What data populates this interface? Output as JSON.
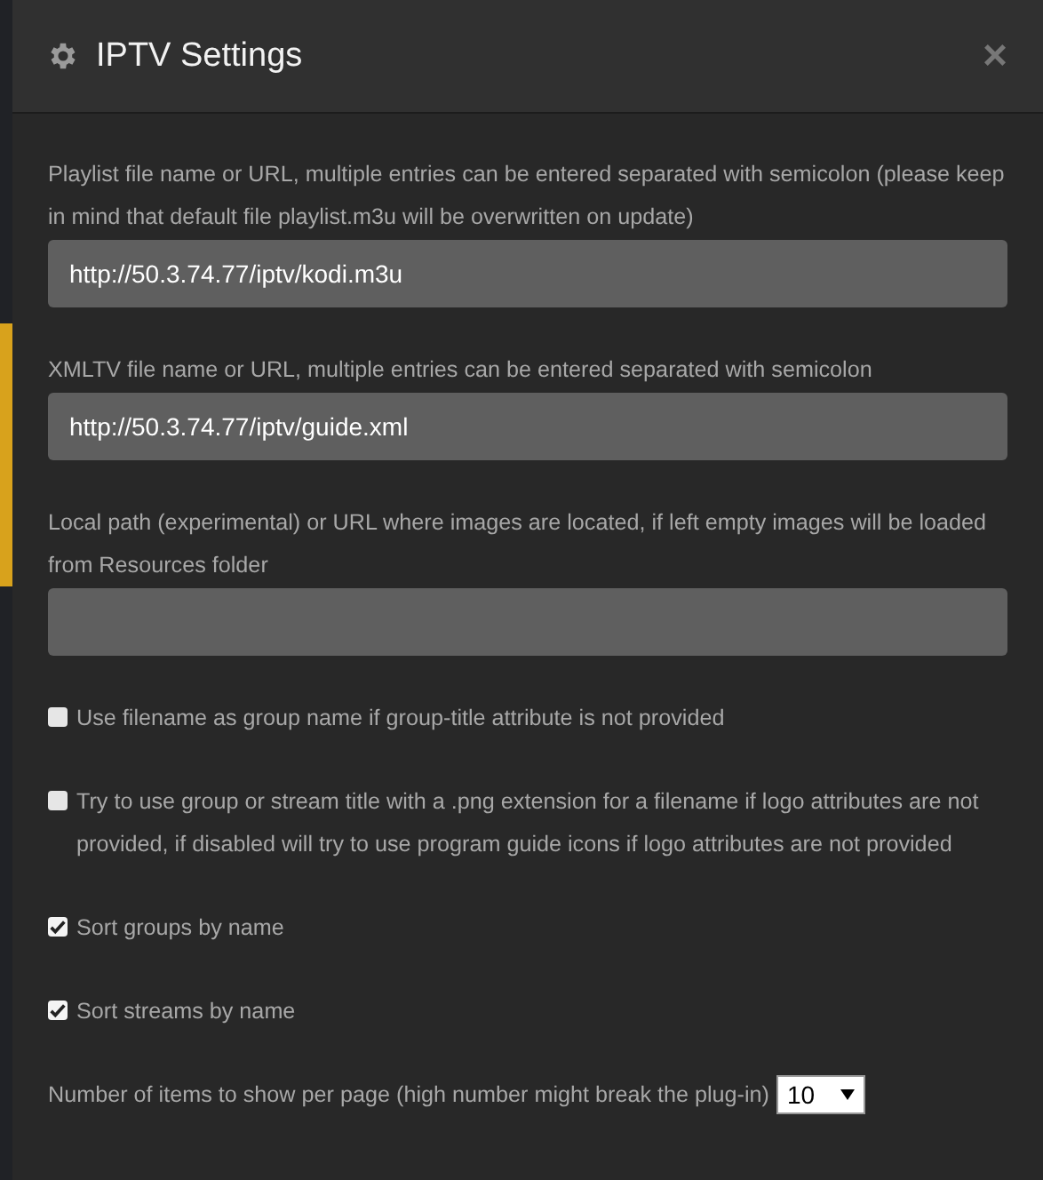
{
  "dialog": {
    "title": "IPTV Settings",
    "close": "×"
  },
  "settings": [
    {
      "kind": "text",
      "label": "Playlist file name or URL, multiple entries can be entered separated with semicolon (please keep in mind that default file playlist.m3u will be overwritten on update)",
      "value": "http://50.3.74.77/iptv/kodi.m3u"
    },
    {
      "kind": "text",
      "label": "XMLTV file name or URL, multiple entries can be entered separated with semicolon",
      "value": "http://50.3.74.77/iptv/guide.xml"
    },
    {
      "kind": "text",
      "label": "Local path (experimental) or URL where images are located, if left empty images will be loaded from Resources folder"
    },
    {
      "kind": "checkbox",
      "label": "Use filename as group name if group-title attribute is not provided",
      "checked": false
    },
    {
      "kind": "checkbox",
      "label": "Try to use group or stream title with a .png extension for a filename if logo attributes are not provided, if disabled will try to use program guide icons if logo attributes are not provided",
      "checked": false
    },
    {
      "kind": "checkbox",
      "label": "Sort groups by name",
      "checked": true
    },
    {
      "kind": "checkbox",
      "label": "Sort streams by name",
      "checked": true
    },
    {
      "kind": "select",
      "label": "Number of items to show per page (high number might break the plug-in)",
      "value": "10"
    }
  ]
}
